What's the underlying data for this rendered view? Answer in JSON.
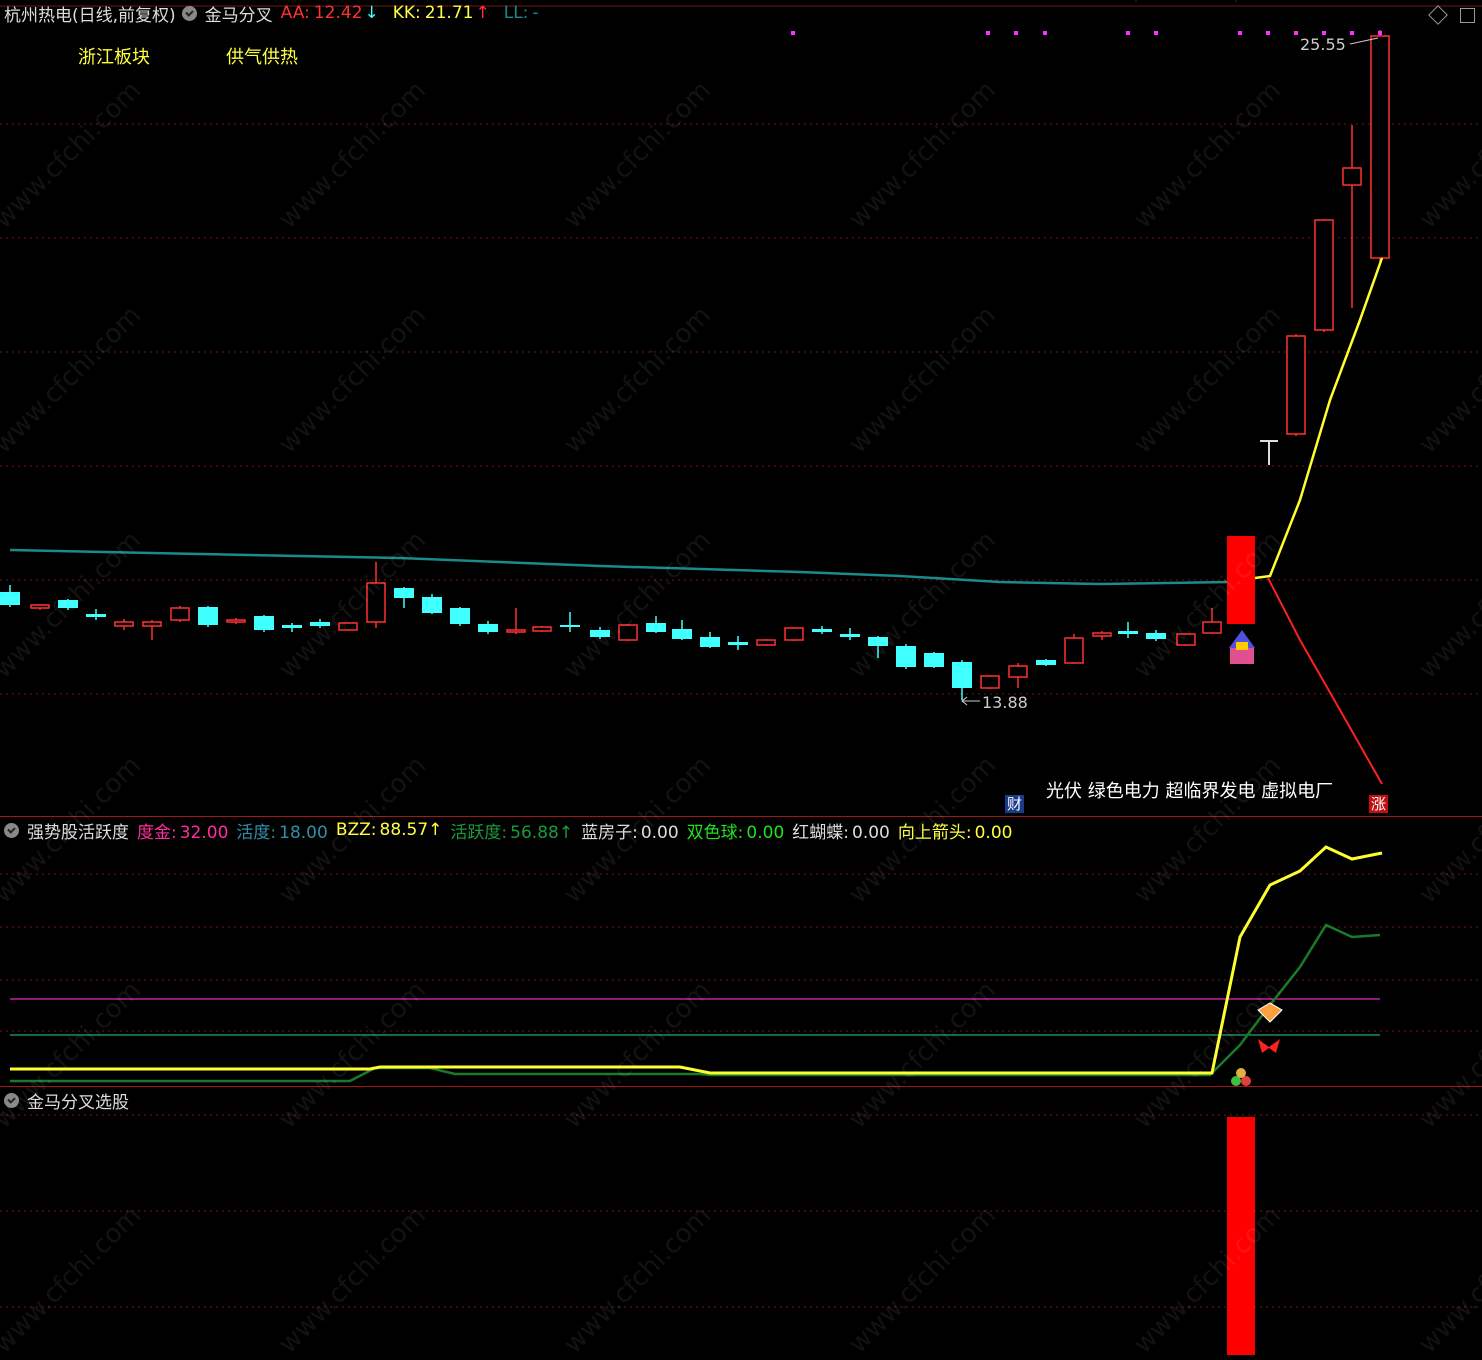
{
  "main_panel": {
    "stock_title": "杭州热电",
    "stock_period": "(日线,前复权)",
    "indicator_name": "金马分叉",
    "aa_label": "AA:",
    "aa_value": "12.42",
    "aa_arrow": "↓",
    "kk_label": "KK:",
    "kk_value": "21.71",
    "kk_arrow": "↑",
    "ll_label": "LL:",
    "ll_value": "-",
    "tag_left": "浙江板块",
    "tag_right": "供气供热",
    "high_label": "25.55",
    "low_label": "13.88",
    "concepts": "光伏 绿色电力 超临界发电 虚拟电厂",
    "badge_cai": "财",
    "badge_zhang": "涨"
  },
  "sub_panel_1": {
    "name": "强势股活跃度",
    "items": [
      {
        "label": "度金:",
        "value": "32.00",
        "color": "#ff2fa0",
        "vcolor": "#ff2fa0"
      },
      {
        "label": "活度:",
        "value": "18.00",
        "color": "#2f8fa8",
        "vcolor": "#2f8fa8"
      },
      {
        "label": "BZZ:",
        "value": "88.57↑",
        "color": "#ffff40",
        "vcolor": "#ffff40"
      },
      {
        "label": "活跃度:",
        "value": "56.88↑",
        "color": "#1a9a3a",
        "vcolor": "#1a9a3a"
      },
      {
        "label": "蓝房子:",
        "value": "0.00",
        "color": "#dddddd",
        "vcolor": "#dddddd"
      },
      {
        "label": "双色球:",
        "value": "0.00",
        "color": "#20e020",
        "vcolor": "#20e020"
      },
      {
        "label": "红蝴蝶:",
        "value": "0.00",
        "color": "#dddddd",
        "vcolor": "#dddddd"
      },
      {
        "label": "向上箭头:",
        "value": "0.00",
        "color": "#ffff40",
        "vcolor": "#ffff40"
      }
    ]
  },
  "sub_panel_2": {
    "name": "金马分叉选股"
  },
  "watermark": "www.cfchi.com",
  "colors": {
    "up": "#ff3030",
    "down": "#40ffff",
    "ma": "#1a8a8a",
    "yellow": "#ffff30",
    "grid": "#7a1515"
  }
}
